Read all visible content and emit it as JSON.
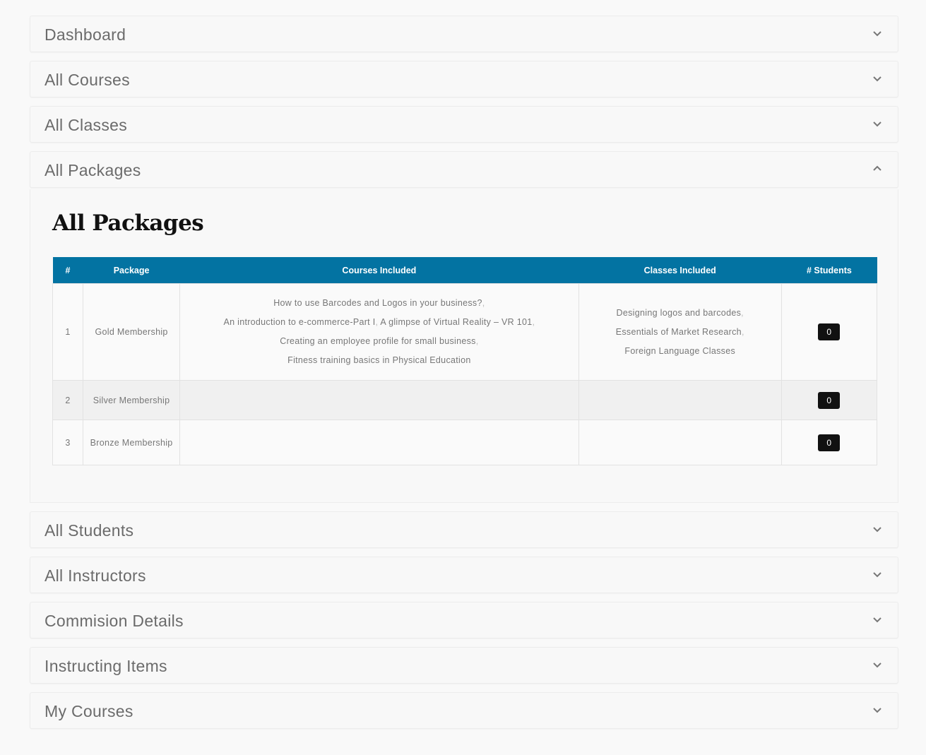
{
  "accordion": {
    "items_top": [
      {
        "title": "Dashboard"
      },
      {
        "title": "All Courses"
      },
      {
        "title": "All Classes"
      },
      {
        "title": "All Packages"
      }
    ],
    "items_bottom": [
      {
        "title": "All Students"
      },
      {
        "title": "All Instructors"
      },
      {
        "title": "Commision Details"
      },
      {
        "title": "Instructing Items"
      },
      {
        "title": "My Courses"
      }
    ]
  },
  "packages": {
    "title": "All Packages",
    "header_color": "#0373a2",
    "columns": [
      "#",
      "Package",
      "Courses Included",
      "Classes Included",
      "# Students"
    ],
    "rows": [
      {
        "num": "1",
        "package": "Gold Membership",
        "courses": [
          "How to use Barcodes and Logos in your business?",
          "An introduction to e-commerce-Part I",
          "A glimpse of Virtual Reality – VR 101",
          "Creating an employee profile for small business",
          "Fitness training basics in Physical Education"
        ],
        "classes": [
          "Designing logos and barcodes",
          "Essentials of Market Research",
          "Foreign Language Classes"
        ],
        "students": "0"
      },
      {
        "num": "2",
        "package": "Silver Membership",
        "students": "0"
      },
      {
        "num": "3",
        "package": "Bronze Membership",
        "students": "0"
      }
    ]
  }
}
